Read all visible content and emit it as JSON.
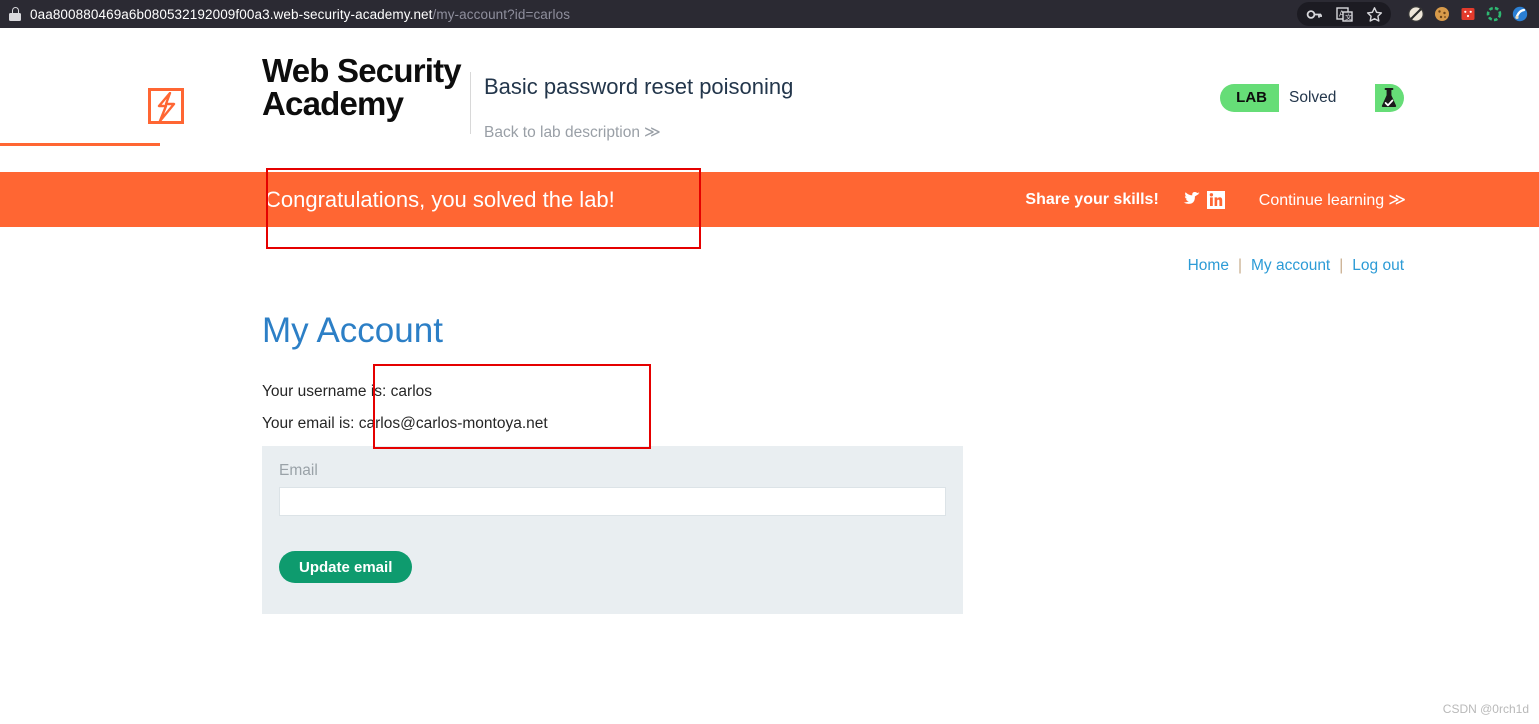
{
  "browser": {
    "url_host": "0aa800880469a6b080532192009f00a3.web-security-academy.net",
    "url_path": "/my-account?id=carlos",
    "lock_icon": "padlock-secure-icon",
    "toolbar_icons": [
      {
        "name": "password-key-icon",
        "glyph": "⚷"
      },
      {
        "name": "translate-icon",
        "glyph": "文"
      },
      {
        "name": "bookmark-star-icon",
        "glyph": "☆"
      }
    ],
    "extension_icons": [
      {
        "name": "noscript-extension-icon",
        "color": "#e8e2d8"
      },
      {
        "name": "cookie-manager-extension-icon",
        "color": "#d79a4a"
      },
      {
        "name": "foxyproxy-extension-icon",
        "color": "#e33b2c"
      },
      {
        "name": "wappalyzer-extension-icon",
        "color": "#2eb872"
      },
      {
        "name": "burp-extension-icon",
        "color": "#2b7fd4"
      }
    ]
  },
  "lab_header": {
    "logo_line1": "Web Security",
    "logo_line2": "Academy",
    "logo_bolt_icon": "lightning-bolt-icon",
    "title": "Basic password reset poisoning",
    "back_link": "Back to lab description",
    "back_chevron": "≫",
    "status_tag": "LAB",
    "status_value": "Solved",
    "status_icon": "flask-check-icon",
    "status_color": "#66dd77"
  },
  "banner": {
    "message": "Congratulations, you solved the lab!",
    "share_label": "Share your skills!",
    "twitter_icon": "twitter-bird-icon",
    "linkedin_icon": "linkedin-icon",
    "continue_label": "Continue learning",
    "continue_chevron": "≫",
    "background": "#ff6633"
  },
  "nav": {
    "home": "Home",
    "my_account": "My account",
    "log_out": "Log out",
    "separator": "|"
  },
  "account": {
    "heading": "My Account",
    "username_line": "Your username is: carlos",
    "email_line": "Your email is: carlos@carlos-montoya.net"
  },
  "form": {
    "email_label": "Email",
    "email_value": "",
    "email_placeholder": "",
    "submit_label": "Update email",
    "submit_color": "#0e9b6e"
  },
  "annotations": {
    "box1_name": "red-highlight-banner",
    "box2_name": "red-highlight-account-details",
    "color": "#e50000"
  },
  "watermark": "CSDN @0rch1d"
}
